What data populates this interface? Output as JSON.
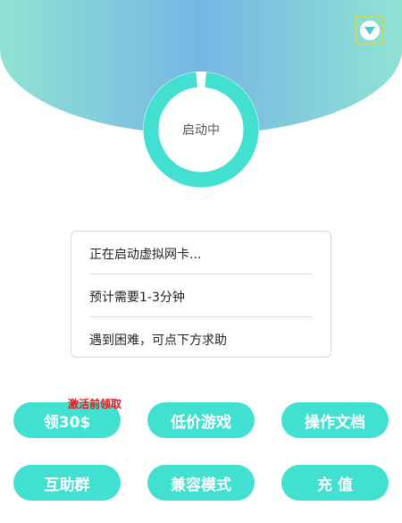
{
  "status": {
    "ring_label": "启动中",
    "progress": 0.97
  },
  "info": {
    "lines": [
      "正在启动虚拟网卡...",
      "预计需要1-3分钟",
      "遇到困难，可点下方求助"
    ]
  },
  "badge": {
    "text": "激活前领取"
  },
  "buttons": {
    "row1": [
      "领30$",
      "低价游戏",
      "操作文档"
    ],
    "row2": [
      "互助群",
      "兼容模式",
      "充 值"
    ]
  },
  "colors": {
    "accent": "#41e0d0",
    "header_gradient": [
      "#8fe3d3",
      "#76b6e4"
    ],
    "badge": "#e0161e"
  },
  "icons": {
    "dropdown": "chevron-down-circle-icon"
  }
}
